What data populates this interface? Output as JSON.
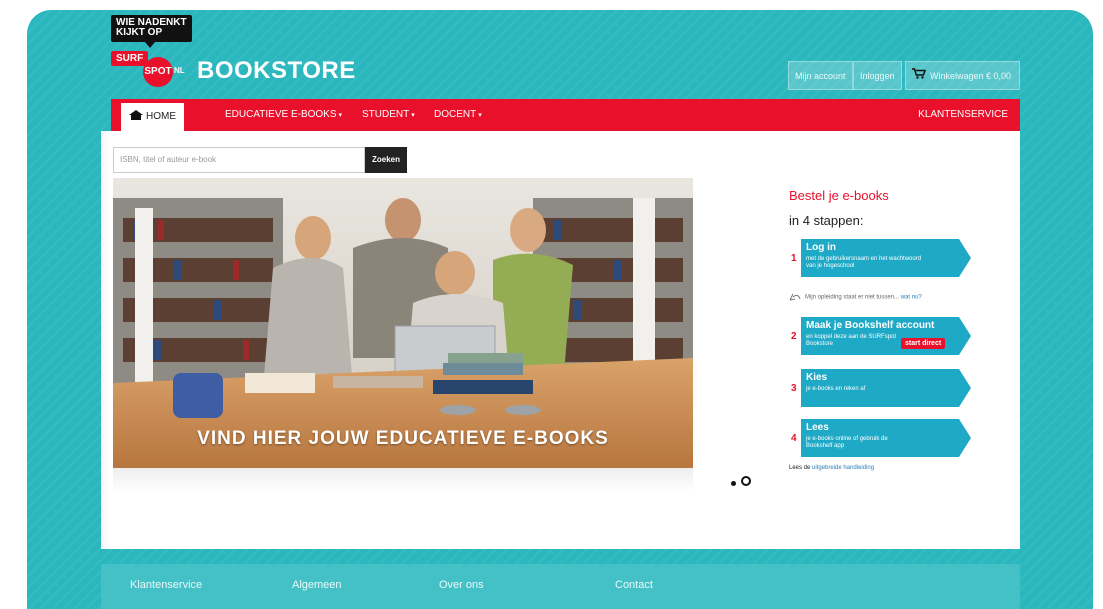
{
  "logo": {
    "badge_line1": "WIE NADENKT",
    "badge_line2": "KIJKT OP",
    "surf": "SURF",
    "spot": "SPOT",
    "nl": "NL",
    "brand": "BOOKSTORE"
  },
  "header": {
    "account_label": "Mijn account",
    "login_label": "Inloggen",
    "cart_label": "Winkelwagen € 0,00"
  },
  "nav": {
    "home": "HOME",
    "items": [
      "EDUCATIEVE E-BOOKS",
      "STUDENT",
      "DOCENT"
    ],
    "right": "KLANTENSERVICE"
  },
  "search": {
    "placeholder": "ISBN, titel of auteur e-book",
    "button": "Zoeken"
  },
  "hero": {
    "title": "VIND HIER JOUW EDUCATIEVE E-BOOKS"
  },
  "steps_panel": {
    "title": "Bestel je e-books",
    "subtitle": "in 4 stappen:",
    "steps": [
      {
        "num": "1",
        "title": "Log in",
        "desc": "met de gebruikersnaam en het wachtwoord van je hogeschool"
      },
      {
        "num": "2",
        "title": "Maak je Bookshelf account",
        "desc": "en koppel deze aan de SURFspot Bookstore",
        "cta": "start direct"
      },
      {
        "num": "3",
        "title": "Kies",
        "desc": "je e-books en reken af"
      },
      {
        "num": "4",
        "title": "Lees",
        "desc": "je e-books online of gebruik de Bookshelf app"
      }
    ],
    "note_text": "Mijn opleiding staat er niet tussen...",
    "note_link": "wat nu?",
    "guide_text": "Lees de",
    "guide_link": "uitgebreide handleiding"
  },
  "footer": {
    "links": [
      "Klantenservice",
      "Algemeen",
      "Over ons",
      "Contact"
    ]
  },
  "colors": {
    "teal": "#2ab7bd",
    "red": "#e8102b",
    "step_blue": "#1ea9c6"
  }
}
